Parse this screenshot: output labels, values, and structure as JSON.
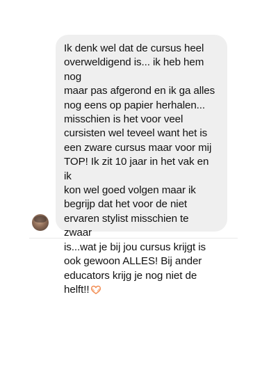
{
  "conversation": {
    "messages": [
      {
        "sender": "other",
        "text": "Ik denk wel dat de cursus heel\noverweldigend is... ik heb hem nog\nmaar pas afgerond en ik ga alles\nnog eens op papier herhalen...\nmisschien is het voor veel\ncursisten wel teveel want het is\neen zware cursus maar voor mij\nTOP! Ik zit 10 jaar in het vak en ik\nkon wel goed volgen maar ik\nbegrijp dat het voor de niet\nervaren stylist misschien te zwaar\nis...wat je bij jou cursus krijgt is\nook gewoon ALLES! Bij ander\neducators krijg je nog niet de\nhelft!!",
        "emoji": "heart-hands-emoji"
      }
    ]
  },
  "colors": {
    "bubble_background": "#efefef",
    "text": "#111111",
    "emoji_orange": "#f28b50"
  }
}
